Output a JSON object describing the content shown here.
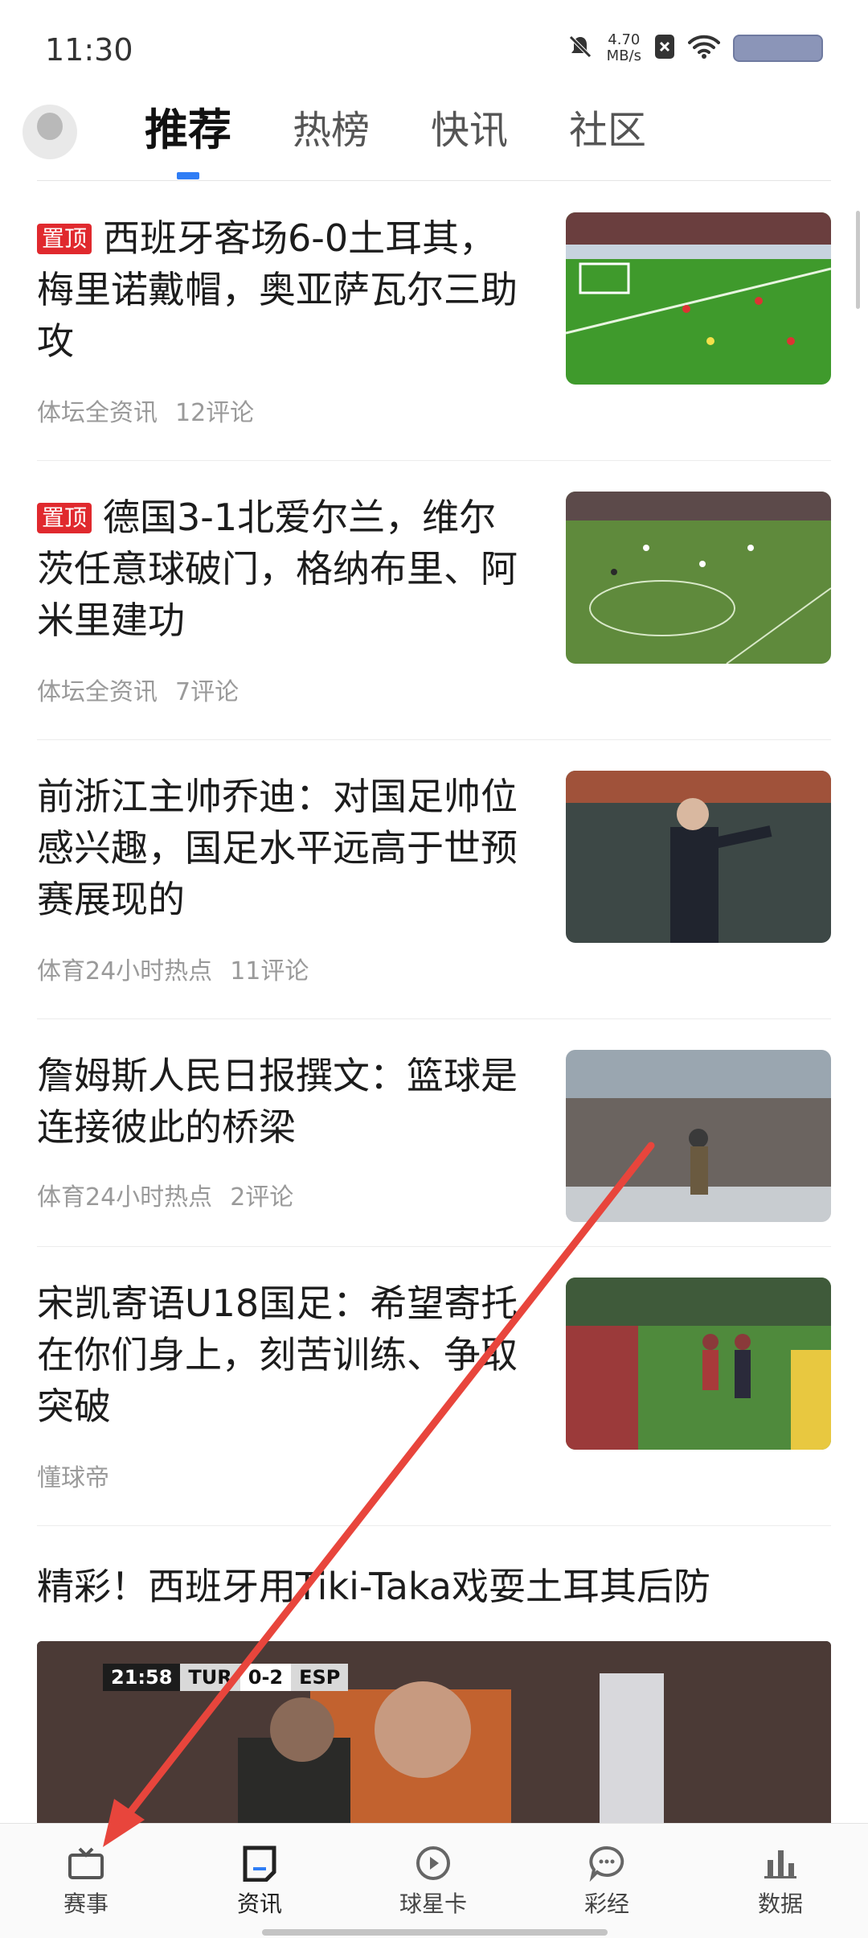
{
  "status_bar": {
    "time": "11:30",
    "net_speed_value": "4.70",
    "net_speed_unit": "MB/s"
  },
  "header": {
    "tabs": [
      "推荐",
      "热榜",
      "快讯",
      "社区"
    ],
    "active_tab": "推荐"
  },
  "feed": [
    {
      "pin": "置顶",
      "title": "西班牙客场6-0土耳其，梅里诺戴帽，奥亚萨瓦尔三助攻",
      "source": "体坛全资讯",
      "comments": "12评论"
    },
    {
      "pin": "置顶",
      "title": "德国3-1北爱尔兰，维尔茨任意球破门，格纳布里、阿米里建功",
      "source": "体坛全资讯",
      "comments": "7评论"
    },
    {
      "pin": "",
      "title": "前浙江主帅乔迪：对国足帅位感兴趣，国足水平远高于世预赛展现的",
      "source": "体育24小时热点",
      "comments": "11评论"
    },
    {
      "pin": "",
      "title": "詹姆斯人民日报撰文：篮球是连接彼此的桥梁",
      "source": "体育24小时热点",
      "comments": "2评论"
    },
    {
      "pin": "",
      "title": "宋凯寄语U18国足：希望寄托在你们身上，刻苦训练、争取突破",
      "source": "懂球帝",
      "comments": ""
    }
  ],
  "video": {
    "title": "精彩！西班牙用Tiki-Taka戏耍土耳其后防",
    "clock": "21:58",
    "home": "TUR",
    "score": "0-2",
    "away": "ESP"
  },
  "bottom_nav": [
    "赛事",
    "资讯",
    "球星卡",
    "彩经",
    "数据"
  ],
  "colors": {
    "accent": "#2f7df5",
    "pin_red": "#e0292e",
    "annotation": "#e8453c"
  }
}
